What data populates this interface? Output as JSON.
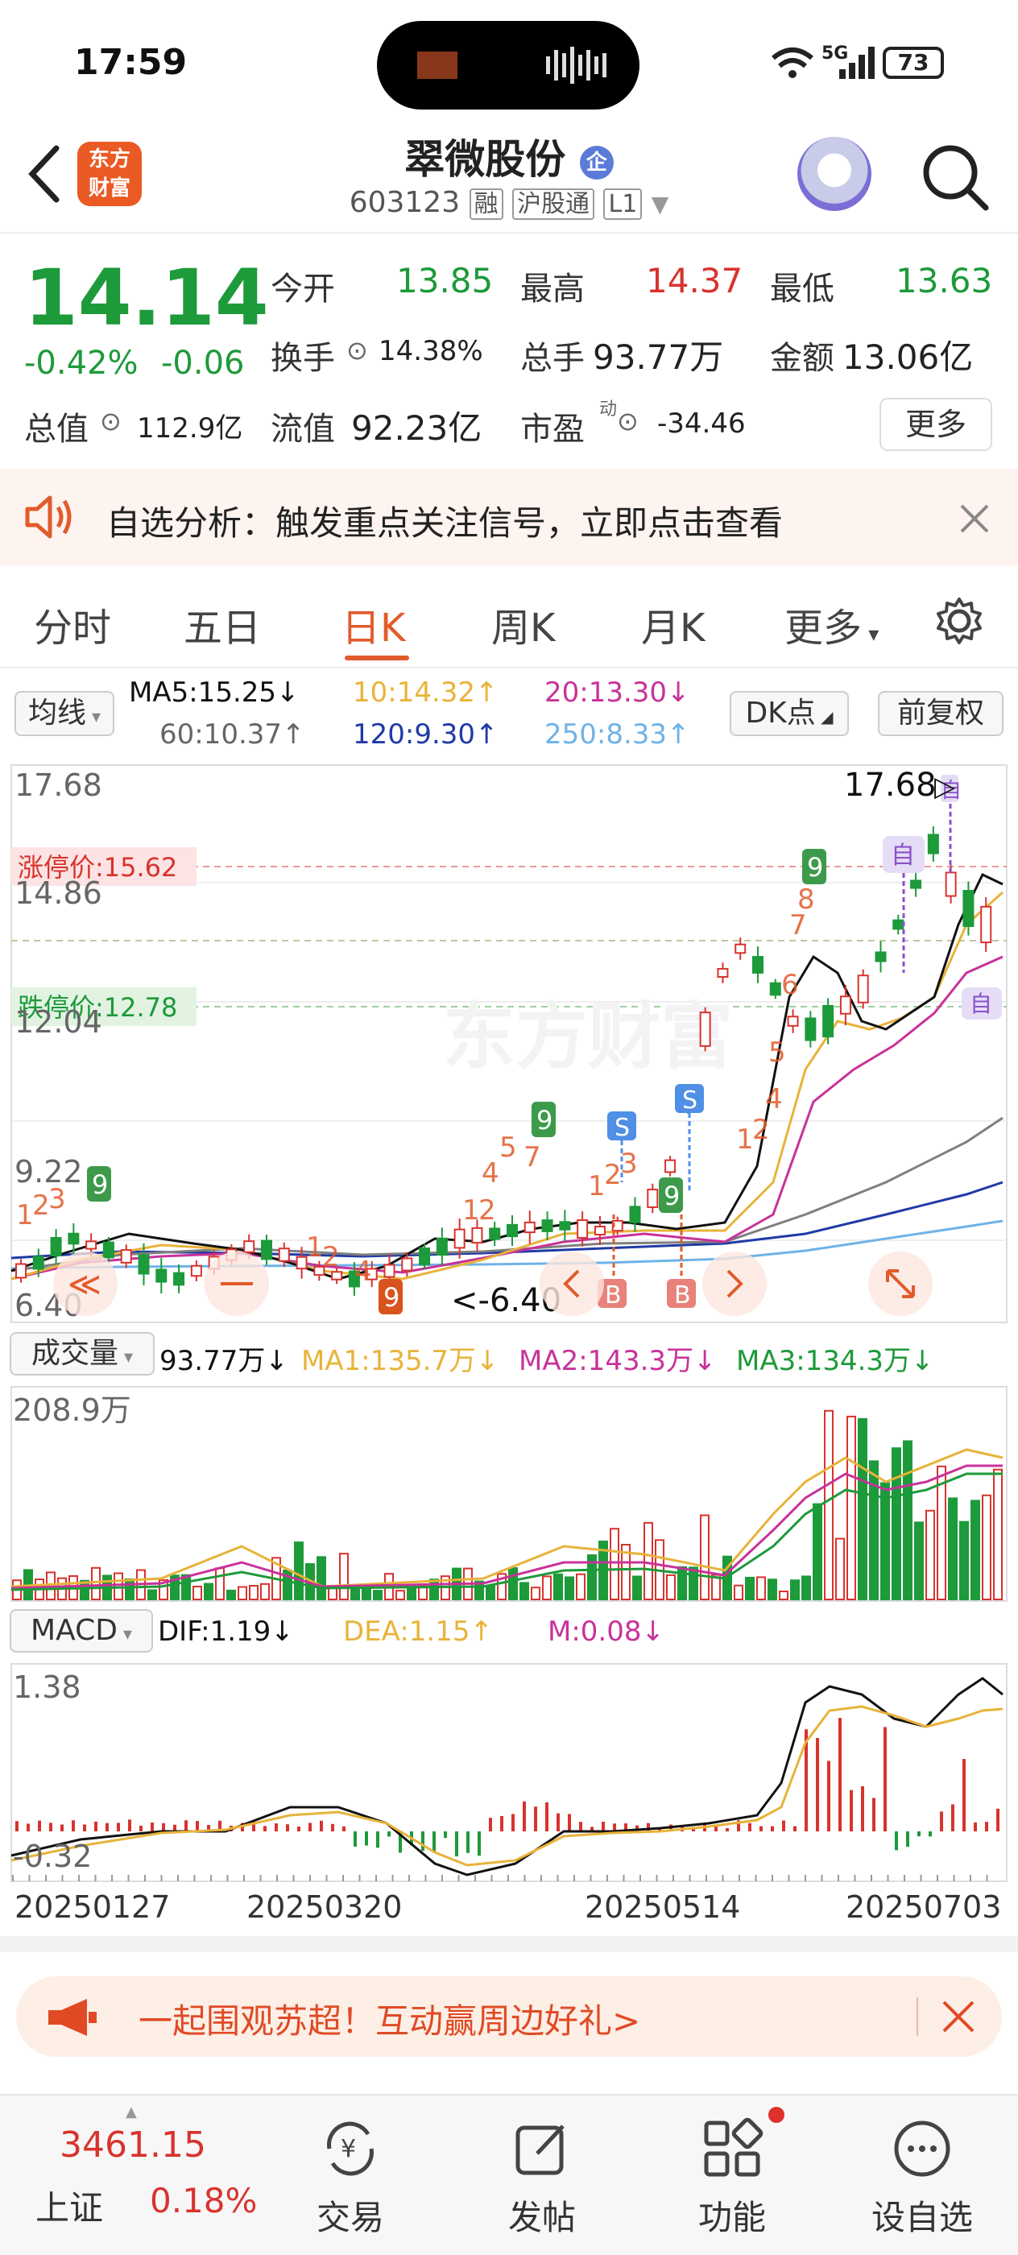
{
  "status_bar": {
    "time": "17:59",
    "network": "5G",
    "battery": "73"
  },
  "header": {
    "logo_text_1": "东方",
    "logo_text_2": "财富",
    "stock_name": "翠微股份",
    "name_badge": "企",
    "code": "603123",
    "tags": [
      "融",
      "沪股通",
      "L1"
    ]
  },
  "quote": {
    "price": "14.14",
    "change_pct": "-0.42%",
    "change_amt": "-0.06",
    "open_label": "今开",
    "open": "13.85",
    "high_label": "最高",
    "high": "14.37",
    "low_label": "最低",
    "low": "13.63",
    "turnover_label": "换手",
    "turnover": "14.38%",
    "volume_label": "总手",
    "volume": "93.77万",
    "amount_label": "金额",
    "amount": "13.06亿",
    "mktcap_label": "总值",
    "mktcap": "112.9亿",
    "float_label": "流值",
    "float_cap": "92.23亿",
    "pe_label": "市盈",
    "pe_sup": "动",
    "pe": "-34.46",
    "more_button": "更多"
  },
  "notice": {
    "text": "自选分析：触发重点关注信号，立即点击查看"
  },
  "tabs": [
    "分时",
    "五日",
    "日K",
    "周K",
    "月K",
    "更多"
  ],
  "active_tab": 2,
  "ma_legend": {
    "selector": "均线",
    "ma5": "MA5:15.25↓",
    "ma10": "10:14.32↑",
    "ma20": "20:13.30↓",
    "ma60": "60:10.37↑",
    "ma120": "120:9.30↑",
    "ma250": "250:8.33↑",
    "dk_button": "DK点",
    "adjust_button": "前复权"
  },
  "colors": {
    "up": "#d8332d",
    "down": "#1d9a3a",
    "accent": "#e25b2b",
    "ma5": "#111111",
    "ma10": "#e8b33a",
    "ma20": "#c8329a",
    "ma60": "#7f7f7f",
    "ma120": "#1f3aa6",
    "ma250": "#6fb3e8"
  },
  "kline": {
    "y_labels": [
      "17.68",
      "14.86",
      "12.04",
      "9.22",
      "6.40"
    ],
    "limit_up": "涨停价:15.62",
    "limit_down": "跌停价:12.78",
    "max_marker": "17.68",
    "min_marker": "<-6.40",
    "watch_marker": "自",
    "signal_s": "S",
    "signal_b": "B",
    "td_nine": "9"
  },
  "volume_panel": {
    "selector": "成交量",
    "current": "93.77万↓",
    "ma1": "MA1:135.7万↓",
    "ma2": "MA2:143.3万↓",
    "ma3": "MA3:134.3万↓",
    "max_label": "208.9万"
  },
  "macd_panel": {
    "selector": "MACD",
    "dif": "DIF:1.19↓",
    "dea": "DEA:1.15↑",
    "m": "M:0.08↓",
    "top_label": "1.38",
    "bottom_label": "-0.32"
  },
  "dates": [
    "20250127",
    "20250320",
    "20250514",
    "20250703"
  ],
  "banner": {
    "text": "一起围观苏超！互动赢周边好礼>"
  },
  "bottom_bar": {
    "index_value": "3461.15",
    "index_name": "上证",
    "index_change": "0.18%",
    "items": [
      "交易",
      "发帖",
      "功能",
      "设自选"
    ]
  }
}
